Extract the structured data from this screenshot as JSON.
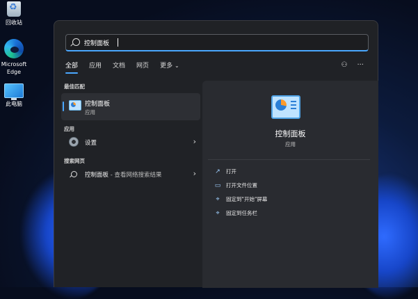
{
  "desktop": {
    "icons": [
      {
        "label": "回收站",
        "icon": "recycle-bin-icon"
      },
      {
        "label": "Microsoft Edge",
        "icon": "edge-icon"
      },
      {
        "label": "此电脑",
        "icon": "computer-icon"
      }
    ]
  },
  "search": {
    "value": "控制面板",
    "icon": "search-icon"
  },
  "tabs": [
    {
      "label": "全部",
      "active": true
    },
    {
      "label": "应用"
    },
    {
      "label": "文档"
    },
    {
      "label": "网页"
    },
    {
      "label": "更多"
    }
  ],
  "header_icons": [
    "share-icon",
    "more-icon"
  ],
  "sections": {
    "best_match": {
      "title": "最佳匹配",
      "name": "控制面板",
      "type": "应用"
    },
    "apps": {
      "title": "应用",
      "item": "设置"
    },
    "web": {
      "title": "搜索网页",
      "item_name": "控制面板",
      "item_sub": " - 查看网络搜索结果"
    }
  },
  "detail": {
    "name": "控制面板",
    "type": "应用",
    "actions": [
      {
        "label": "打开",
        "icon": "open-icon"
      },
      {
        "label": "打开文件位置",
        "icon": "folder-icon"
      },
      {
        "label": "固定到\"开始\"屏幕",
        "icon": "pin-icon"
      },
      {
        "label": "固定到任务栏",
        "icon": "pin-icon"
      }
    ]
  },
  "colors": {
    "accent": "#4aa8ff",
    "panel": "#202226",
    "detail_panel": "#292b30"
  }
}
